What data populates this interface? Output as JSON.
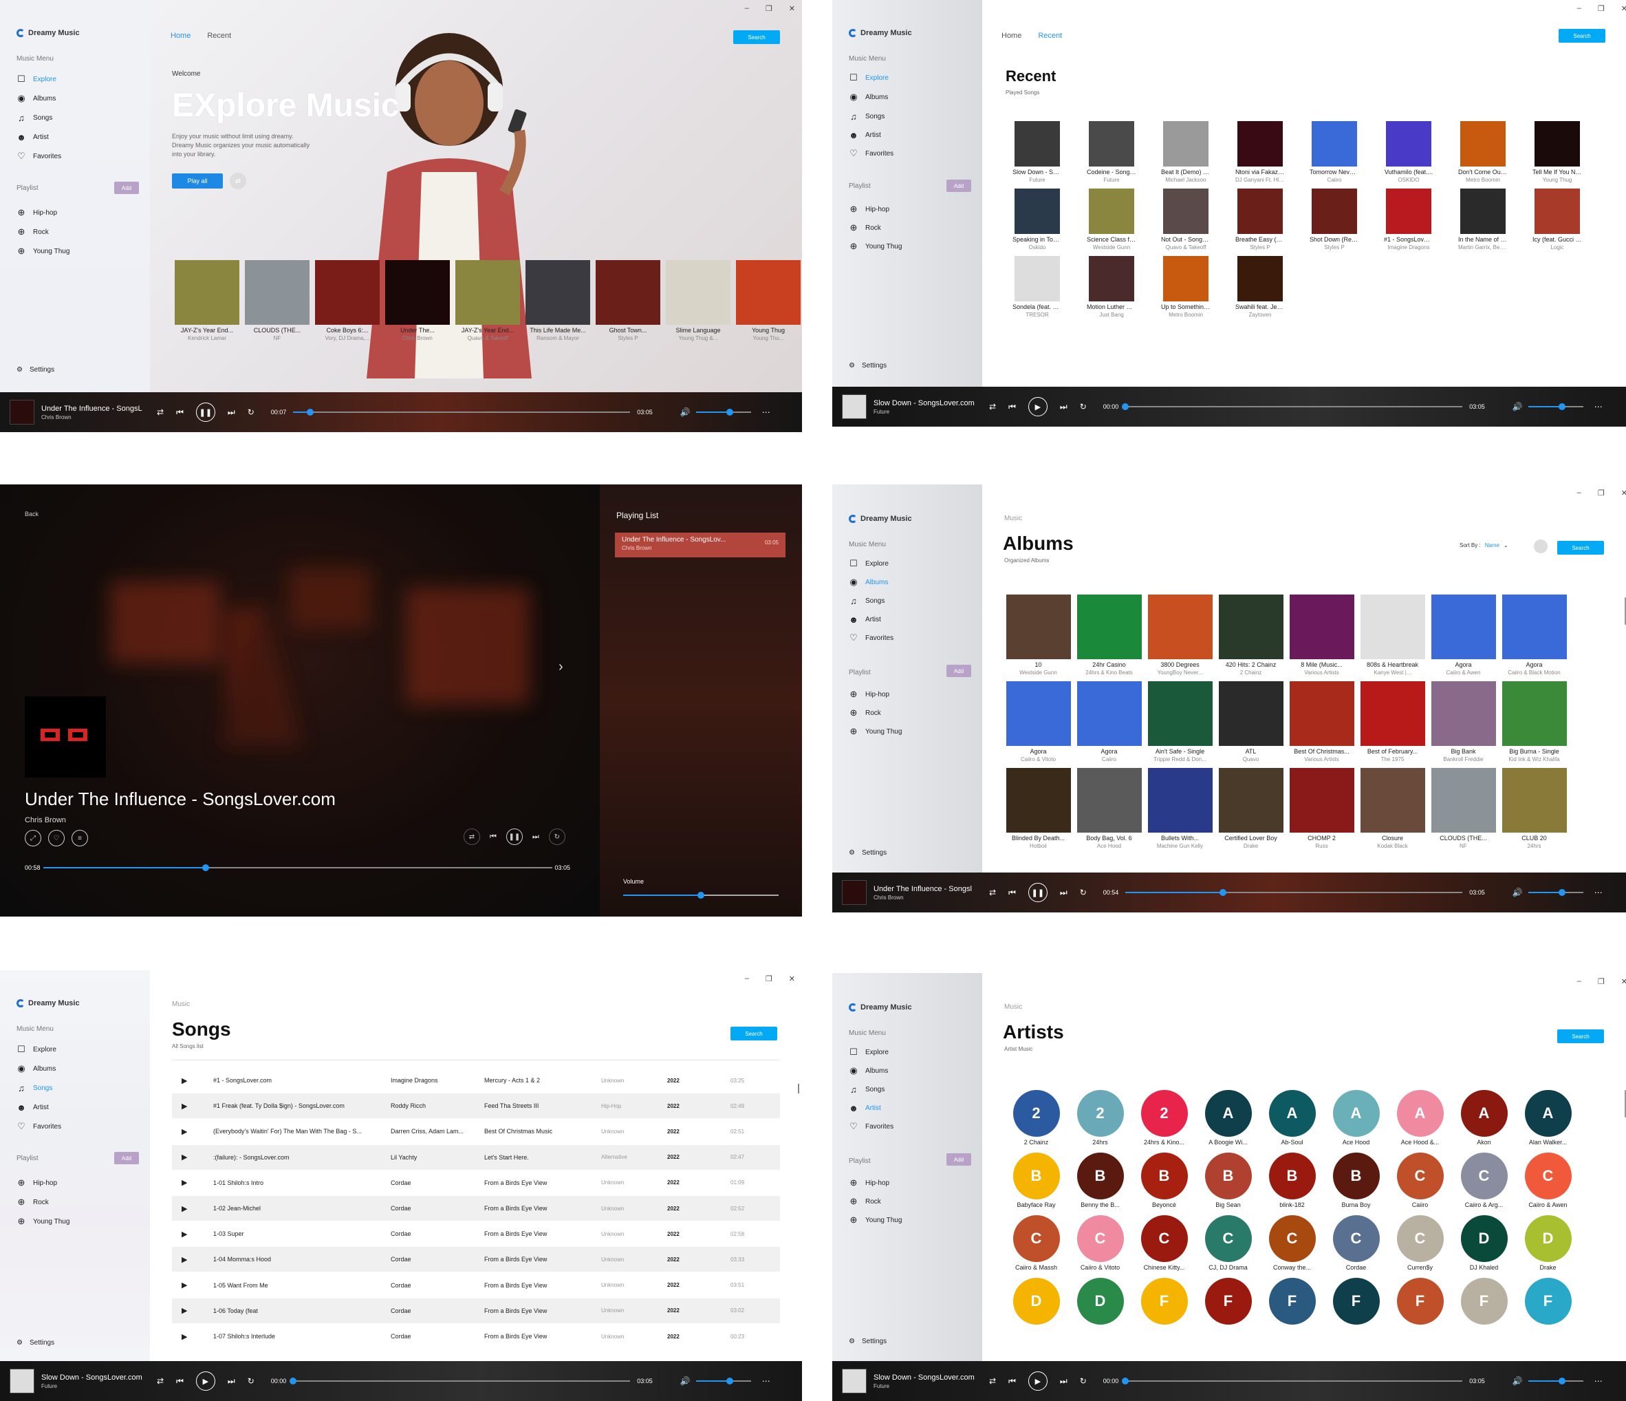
{
  "common": {
    "app_name": "Dreamy Music",
    "menu_section": "Music Menu",
    "menu": [
      "Explore",
      "Albums",
      "Songs",
      "Artist",
      "Favorites"
    ],
    "playlist_section": "Playlist",
    "add_label": "Add",
    "playlists": [
      "Hip-hop",
      "Rock",
      "Young Thug"
    ],
    "settings": "Settings",
    "search": "Search",
    "nav_home": "Home",
    "nav_recent": "Recent",
    "crumb": "Music"
  },
  "player_a": {
    "title": "Under The Influence - SongsL",
    "artist": "Chris Brown",
    "time": "00:07",
    "total": "03:05",
    "progress": 0.05
  },
  "player_b": {
    "title": "Slow Down - SongsLover.com",
    "artist": "Future",
    "time": "00:00",
    "total": "03:05",
    "progress": 0.0
  },
  "player_c": {
    "title": "Under The Influence - Songsl",
    "artist": "Chris Brown",
    "time": "00:54",
    "total": "03:05",
    "progress": 0.29
  },
  "volume": 0.62,
  "home": {
    "welcome": "Welcome",
    "headline": "EXplore Music",
    "description": "Enjoy your music without limit using dreamy. Dreamy Music organizes your music automatically into your library.",
    "play_all": "Play all",
    "featured": [
      {
        "title": "JAY-Z's Year End...",
        "artist": "Kendrick Lamar",
        "color": "#8a8640"
      },
      {
        "title": "CLOUDS (THE...",
        "artist": "NF",
        "color": "#8b9298"
      },
      {
        "title": "Coke Boys 6:...",
        "artist": "Vory, DJ Drama,...",
        "color": "#7a1d18"
      },
      {
        "title": "Under The...",
        "artist": "Chris Brown",
        "color": "#1a0808"
      },
      {
        "title": "JAY-Z's Year End...",
        "artist": "Quavo & Takeoff",
        "color": "#8a8640"
      },
      {
        "title": "This Life Made Me...",
        "artist": "Ransom & Mayor",
        "color": "#3a3a40"
      },
      {
        "title": "Ghost Town...",
        "artist": "Styles P",
        "color": "#6a2018"
      },
      {
        "title": "Slime Language",
        "artist": "Young Thug &...",
        "color": "#d8d4c8"
      },
      {
        "title": "Young Thug",
        "artist": "Young Thu...",
        "color": "#c84020"
      }
    ]
  },
  "recent": {
    "title": "Recent",
    "subtitle": "Played Songs",
    "items": [
      {
        "title": "Slow Down - Song...",
        "artist": "Future",
        "color": "#3a3a3a"
      },
      {
        "title": "Codeine - SongsL...",
        "artist": "Future",
        "color": "#4a4a4a"
      },
      {
        "title": "Beat It (Demo) - S...",
        "artist": "Michael Jackson",
        "color": "#9a9a9a"
      },
      {
        "title": "Ntoni via Fakaza.Me",
        "artist": "DJ Ganyani  Ft. Hloni",
        "color": "#3a0a14"
      },
      {
        "title": "Tomorrow Never...",
        "artist": "Caiiro",
        "color": "#3a6ad8"
      },
      {
        "title": "Vuthamilo (feat....",
        "artist": "OSKIDO",
        "color": "#4a3ac8"
      },
      {
        "title": "Don't Come Out t...",
        "artist": "Metro Boomin",
        "color": "#c85a10"
      },
      {
        "title": "Tell Me If You Nee...",
        "artist": "Young Thug",
        "color": "#1a0a0a"
      },
      {
        "title": "Speaking in Tongu...",
        "artist": "Oskido",
        "color": "#2a3a4a"
      },
      {
        "title": "Science Class feat...",
        "artist": "Westside Gunn",
        "color": "#8a8640"
      },
      {
        "title": "Not Out - SongsL...",
        "artist": "Quavo & Takeoff",
        "color": "#5a4a4a"
      },
      {
        "title": "Breathe Easy (Rem...",
        "artist": "Styles P",
        "color": "#6a2018"
      },
      {
        "title": "Shot Down (Remix...",
        "artist": "Styles P",
        "color": "#6a2018"
      },
      {
        "title": "#1 - SongsLover.co...",
        "artist": "Imagine Dragons",
        "color": "#b81a20"
      },
      {
        "title": "In the Name of Lo...",
        "artist": "Martin Garrix, Bebe...",
        "color": "#2a2a2a"
      },
      {
        "title": "Icy (feat. Gucci Ma...",
        "artist": "Logic",
        "color": "#a83a2a"
      },
      {
        "title": "Sondela (feat. Msa...",
        "artist": "TRESOR",
        "color": "#ddd"
      },
      {
        "title": "Motion Luther Kin...",
        "artist": "Just Bang",
        "color": "#4a2a2a"
      },
      {
        "title": "Up to Something (...",
        "artist": "Metro Boomin",
        "color": "#c85a10"
      },
      {
        "title": "Swahili feat. Jefe...",
        "artist": "Zaytoven",
        "color": "#3a1a0a"
      }
    ]
  },
  "nowplaying": {
    "back": "Back",
    "title": "Under The Influence - SongsLover.com",
    "artist": "Chris Brown",
    "time": "00:58",
    "total": "03:05",
    "progress": 0.32,
    "list_title": "Playing List",
    "list": [
      {
        "title": "Under The Influence - SongsLov...",
        "artist": "Chris Brown",
        "duration": "03:05"
      }
    ],
    "volume_label": "Volume",
    "volume": 0.5
  },
  "albums": {
    "title": "Albums",
    "subtitle": "Organized Albums",
    "sort_label": "Sort By :",
    "sort_value": "Name",
    "items": [
      {
        "title": "10",
        "artist": "Westside Gunn",
        "color": "#5a4030"
      },
      {
        "title": "24hr Casino",
        "artist": "24hrs & Kino Beats",
        "color": "#1a8a3a"
      },
      {
        "title": "3800 Degrees",
        "artist": "YoungBoy Never...",
        "color": "#c85020"
      },
      {
        "title": "420 Hits: 2 Chainz",
        "artist": "2 Chainz",
        "color": "#2a3a2a"
      },
      {
        "title": "8 Mile (Music...",
        "artist": "Various Artists",
        "color": "#6a1a5a"
      },
      {
        "title": "808s & Heartbreak",
        "artist": "Kanye West |...",
        "color": "#e0e0e0"
      },
      {
        "title": "Agora",
        "artist": "Caiiro & Awen",
        "color": "#3a6ad8"
      },
      {
        "title": "Agora",
        "artist": "Caiiro & Black Motion",
        "color": "#3a6ad8"
      },
      {
        "title": "Agora",
        "artist": "Caiiro & Vitoto",
        "color": "#3a6ad8"
      },
      {
        "title": "Agora",
        "artist": "Caiiro",
        "color": "#3a6ad8"
      },
      {
        "title": "Ain't Safe - Single",
        "artist": "Trippie Redd & Don...",
        "color": "#1a5a3a"
      },
      {
        "title": "ATL",
        "artist": "Quavo",
        "color": "#2a2a2a"
      },
      {
        "title": "Best Of Christmas...",
        "artist": "Various Artists",
        "color": "#a82a1a"
      },
      {
        "title": "Best of February...",
        "artist": "The 1975",
        "color": "#b81a1a"
      },
      {
        "title": "Big Bank",
        "artist": "Bankroll Freddie",
        "color": "#8a6a8a"
      },
      {
        "title": "Big Burna - Single",
        "artist": "Kid Ink & Wiz Khalifa",
        "color": "#3a8a3a"
      },
      {
        "title": "Blinded By Death...",
        "artist": "Hotboii",
        "color": "#3a2a1a"
      },
      {
        "title": "Body Bag, Vol. 6",
        "artist": "Ace Hood",
        "color": "#5a5a5a"
      },
      {
        "title": "Bullets With...",
        "artist": "Machine Gun Kelly",
        "color": "#2a3a8a"
      },
      {
        "title": "Certified Lover Boy",
        "artist": "Drake",
        "color": "#4a3a2a"
      },
      {
        "title": "CHOMP 2",
        "artist": "Russ",
        "color": "#8a1a1a"
      },
      {
        "title": "Closure",
        "artist": "Kodak Black",
        "color": "#6a4a3a"
      },
      {
        "title": "CLOUDS (THE...",
        "artist": "NF",
        "color": "#8b9298"
      },
      {
        "title": "CLUB 20",
        "artist": "24hrs",
        "color": "#8a7a3a"
      }
    ]
  },
  "songs": {
    "title": "Songs",
    "subtitle": "All Songs list",
    "rows": [
      {
        "title": "#1 - SongsLover.com",
        "artist": "Imagine Dragons",
        "album": "Mercury - Acts 1 & 2",
        "genre": "Unknown",
        "year": "2022",
        "duration": "03:25"
      },
      {
        "title": "#1 Freak (feat. Ty Dolla $ign) - SongsLover.com",
        "artist": "Roddy Ricch",
        "album": "Feed Tha Streets III",
        "genre": "Hip-Hop",
        "year": "2022",
        "duration": "02:49"
      },
      {
        "title": "(Everybody's Waitin' For) The Man With The Bag - S...",
        "artist": "Darren Criss, Adam Lam...",
        "album": "Best Of Christmas Music",
        "genre": "Unknown",
        "year": "2022",
        "duration": "02:51"
      },
      {
        "title": ":(failure): - SongsLover.com",
        "artist": "Lil Yachty",
        "album": "Let's Start Here.",
        "genre": "Alternative",
        "year": "2022",
        "duration": "02:47"
      },
      {
        "title": "1-01 Shiloh:s Intro",
        "artist": "Cordae",
        "album": "From a Birds Eye View",
        "genre": "Unknown",
        "year": "2022",
        "duration": "01:09"
      },
      {
        "title": "1-02 Jean-Michel",
        "artist": "Cordae",
        "album": "From a Birds Eye View",
        "genre": "Unknown",
        "year": "2022",
        "duration": "02:52"
      },
      {
        "title": "1-03 Super",
        "artist": "Cordae",
        "album": "From a Birds Eye View",
        "genre": "Unknown",
        "year": "2022",
        "duration": "02:58"
      },
      {
        "title": "1-04 Momma:s Hood",
        "artist": "Cordae",
        "album": "From a Birds Eye View",
        "genre": "Unknown",
        "year": "2022",
        "duration": "03:33"
      },
      {
        "title": "1-05 Want From Me",
        "artist": "Cordae",
        "album": "From a Birds Eye View",
        "genre": "Unknown",
        "year": "2022",
        "duration": "03:51"
      },
      {
        "title": "1-06 Today (feat",
        "artist": "Cordae",
        "album": "From a Birds Eye View",
        "genre": "Unknown",
        "year": "2022",
        "duration": "03:02"
      },
      {
        "title": "1-07 Shiloh:s Interlude",
        "artist": "Cordae",
        "album": "From a Birds Eye View",
        "genre": "Unknown",
        "year": "2022",
        "duration": "00:23"
      }
    ]
  },
  "artists": {
    "title": "Artists",
    "subtitle": "Artist Music",
    "items": [
      {
        "letter": "2",
        "name": "2 Chainz",
        "color": "#2b5aa0"
      },
      {
        "letter": "2",
        "name": "24hrs",
        "color": "#6aaab8"
      },
      {
        "letter": "2",
        "name": "24hrs & Kino...",
        "color": "#e8244a"
      },
      {
        "letter": "A",
        "name": "A Boogie Wi...",
        "color": "#0e3f4a"
      },
      {
        "letter": "A",
        "name": "Ab-Soul",
        "color": "#0e5a62"
      },
      {
        "letter": "A",
        "name": "Ace Hood",
        "color": "#6ab0b8"
      },
      {
        "letter": "A",
        "name": "Ace Hood &...",
        "color": "#f08aa0"
      },
      {
        "letter": "A",
        "name": "Akon",
        "color": "#8a1a10"
      },
      {
        "letter": "A",
        "name": "Alan Walker...",
        "color": "#0e3f4a"
      },
      {
        "letter": "B",
        "name": "Babyface Ray",
        "color": "#f4b400"
      },
      {
        "letter": "B",
        "name": "Benny the B...",
        "color": "#5a1a10"
      },
      {
        "letter": "B",
        "name": "Beyoncé",
        "color": "#a82010"
      },
      {
        "letter": "B",
        "name": "Big Sean",
        "color": "#b04030"
      },
      {
        "letter": "B",
        "name": "blink-182",
        "color": "#9a1a10"
      },
      {
        "letter": "B",
        "name": "Burna Boy",
        "color": "#5a1a10"
      },
      {
        "letter": "C",
        "name": "Caiiro",
        "color": "#c0502a"
      },
      {
        "letter": "C",
        "name": "Caiiro & Arg...",
        "color": "#8a8ca0"
      },
      {
        "letter": "C",
        "name": "Caiiro & Awen",
        "color": "#f05a3a"
      },
      {
        "letter": "C",
        "name": "Caiiro & Massh",
        "color": "#c0502a"
      },
      {
        "letter": "C",
        "name": "Caiiro & Vitoto",
        "color": "#f08aa0"
      },
      {
        "letter": "C",
        "name": "Chinese Kitty...",
        "color": "#9a1a10"
      },
      {
        "letter": "C",
        "name": "CJ, DJ Drama",
        "color": "#2a7a6a"
      },
      {
        "letter": "C",
        "name": "Conway the...",
        "color": "#a84a10"
      },
      {
        "letter": "C",
        "name": "Cordae",
        "color": "#5a7090"
      },
      {
        "letter": "C",
        "name": "Curren$y",
        "color": "#b8b0a0"
      },
      {
        "letter": "D",
        "name": "DJ Khaled",
        "color": "#0a4a3a"
      },
      {
        "letter": "D",
        "name": "Drake",
        "color": "#a8c030"
      },
      {
        "letter": "D",
        "name": "",
        "color": "#f4b400"
      },
      {
        "letter": "D",
        "name": "",
        "color": "#2a8a4a"
      },
      {
        "letter": "F",
        "name": "",
        "color": "#f4b400"
      },
      {
        "letter": "F",
        "name": "",
        "color": "#9a1a10"
      },
      {
        "letter": "F",
        "name": "",
        "color": "#2a5a80"
      },
      {
        "letter": "F",
        "name": "",
        "color": "#0e3f4a"
      },
      {
        "letter": "F",
        "name": "",
        "color": "#c0502a"
      },
      {
        "letter": "F",
        "name": "",
        "color": "#b8b0a0"
      },
      {
        "letter": "F",
        "name": "",
        "color": "#2aa8c8"
      }
    ]
  }
}
